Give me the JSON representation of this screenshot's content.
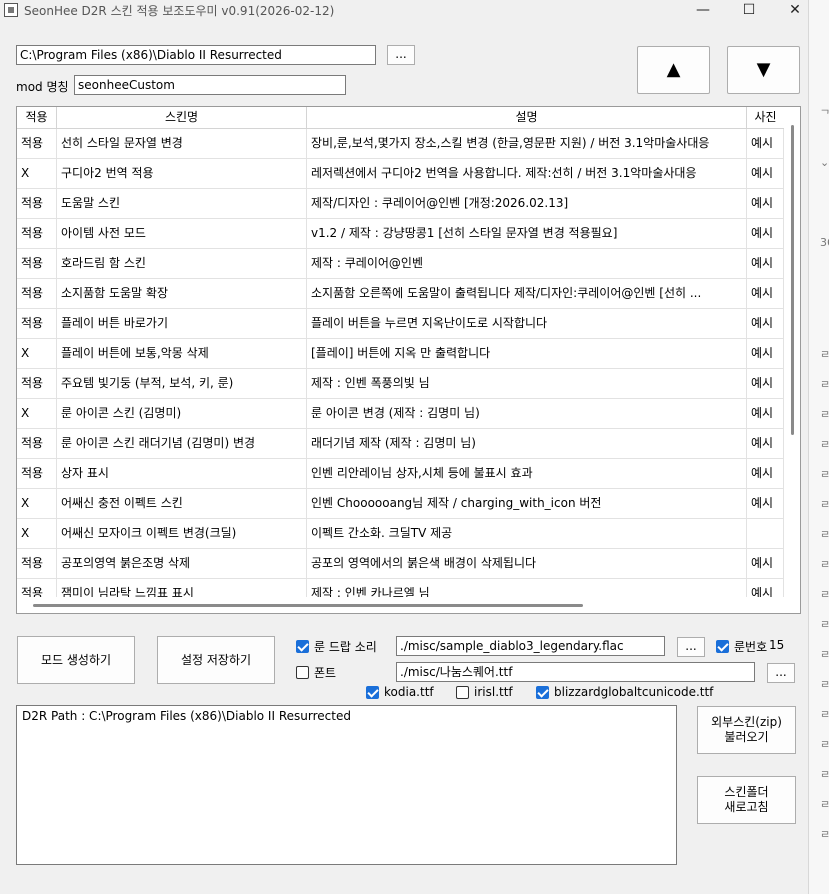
{
  "window": {
    "title": "SeonHee D2R 스킨 적용 보조도우미 v0.91(2026-02-12)",
    "minimize_glyph": "—",
    "maximize_glyph": "☐",
    "close_glyph": "✕"
  },
  "path": {
    "value": "C:\\Program Files (x86)\\Diablo II Resurrected",
    "browse_label": "..."
  },
  "mod": {
    "label": "mod 명칭",
    "value": "seonheeCustom"
  },
  "nav": {
    "up_glyph": "▲",
    "down_glyph": "▼"
  },
  "table": {
    "headers": [
      "적용",
      "스킨명",
      "설명",
      "사진"
    ],
    "rows": [
      {
        "apply": "적용",
        "name": "선히 스타일 문자열 변경",
        "desc": "장비,룬,보석,몇가지 장소,스킬 변경 (한글,영문판 지원) / 버전 3.1악마술사대응",
        "photo": "예시"
      },
      {
        "apply": "X",
        "name": "구디아2 번역 적용",
        "desc": "레저렉션에서 구디아2 번역을 사용합니다. 제작:선히 / 버전 3.1악마술사대응",
        "photo": "예시"
      },
      {
        "apply": "적용",
        "name": "도움말 스킨",
        "desc": "제작/디자인 : 쿠레이어@인벤 [개정:2026.02.13]",
        "photo": "예시"
      },
      {
        "apply": "적용",
        "name": "아이템 사전 모드",
        "desc": "v1.2 / 제작 : 강냥땅콩1 [선히 스타일 문자열 변경 적용필요]",
        "photo": "예시"
      },
      {
        "apply": "적용",
        "name": "호라드림 함 스킨",
        "desc": "제작 : 쿠레이어@인벤",
        "photo": "예시"
      },
      {
        "apply": "적용",
        "name": "소지품함 도움말 확장",
        "desc": "소지품함 오른쪽에 도움말이 출력됩니다  제작/디자인:쿠레이어@인벤 [선히 ...",
        "photo": "예시"
      },
      {
        "apply": "적용",
        "name": "플레이 버튼 바로가기",
        "desc": "플레이 버튼을 누르면 지옥난이도로 시작합니다",
        "photo": "예시"
      },
      {
        "apply": "X",
        "name": "플레이 버튼에 보통,악몽 삭제",
        "desc": "[플레이] 버튼에 지옥 만 출력합니다",
        "photo": "예시"
      },
      {
        "apply": "적용",
        "name": "주요템 빛기둥 (부적, 보석, 키, 룬)",
        "desc": "제작 : 인벤 폭풍의빛 님",
        "photo": "예시"
      },
      {
        "apply": "X",
        "name": "룬 아이콘 스킨 (김명미)",
        "desc": "룬 아이콘 변경 (제작 : 김명미 님)",
        "photo": "예시"
      },
      {
        "apply": "적용",
        "name": "룬 아이콘 스킨 래더기념 (김명미) 변경",
        "desc": "래더기념 제작 (제작 : 김명미 님)",
        "photo": "예시"
      },
      {
        "apply": "적용",
        "name": "상자 표시",
        "desc": "인벤 리안레이님 상자,시체 등에 불표시 효과",
        "photo": "예시"
      },
      {
        "apply": "X",
        "name": "어쌔신 충전 이펙트 스킨",
        "desc": "인벤 Choooooang님 제작 / charging_with_icon 버전",
        "photo": "예시"
      },
      {
        "apply": "X",
        "name": "어쌔신 모자이크 이펙트 변경(크딜)",
        "desc": "이펙트 간소화. 크딜TV 제공",
        "photo": ""
      },
      {
        "apply": "적용",
        "name": "공포의영역 붉은조명 삭제",
        "desc": "공포의 영역에서의 붉은색 배경이 삭제됩니다",
        "photo": "예시"
      },
      {
        "apply": "적용",
        "name": "잼미이 님라탁 느낌표 표시",
        "desc": "제작 : 인벤 카나르엘 님",
        "photo": "예시"
      }
    ]
  },
  "actions": {
    "create_label": "모드 생성하기",
    "save_label": "설정 저장하기",
    "import_label_1": "외부스킨(zip)",
    "import_label_2": "불러오기",
    "refresh_label_1": "스킨폴더",
    "refresh_label_2": "새로고침"
  },
  "options": {
    "rune_sound": {
      "label": "룬 드랍 소리",
      "checked": true,
      "value": "./misc/sample_diablo3_legendary.flac",
      "browse_label": "..."
    },
    "font": {
      "label": "폰트",
      "checked": false,
      "value": "./misc/나눔스퀘어.ttf",
      "browse_label": "..."
    },
    "rune_number": {
      "label": "룬번호",
      "checked": true,
      "value": "15"
    },
    "font_files": [
      {
        "label": "kodia.ttf",
        "checked": true
      },
      {
        "label": "irisl.ttf",
        "checked": false
      },
      {
        "label": "blizzardglobaltcunicode.ttf",
        "checked": true
      }
    ]
  },
  "log": {
    "text": "D2R Path : C:\\Program Files (x86)\\Diablo II Resurrected"
  },
  "colors": {
    "accent": "#1a6fd9",
    "background": "#f0f0f0"
  },
  "right_strip_glyphs": [
    "ᄀ",
    "⌄",
    "36",
    "ㄹ",
    "ㄹ",
    "ㄹ",
    "ㄹ",
    "ㄹ",
    "ㄹ",
    "ㄹ",
    "ㄹ",
    "ㄹ",
    "ㄹ",
    "ㄹ",
    "ㄹ",
    "ㄹ",
    "ㄹ",
    "ㄹ",
    "ㄹ",
    "ㄹ"
  ]
}
